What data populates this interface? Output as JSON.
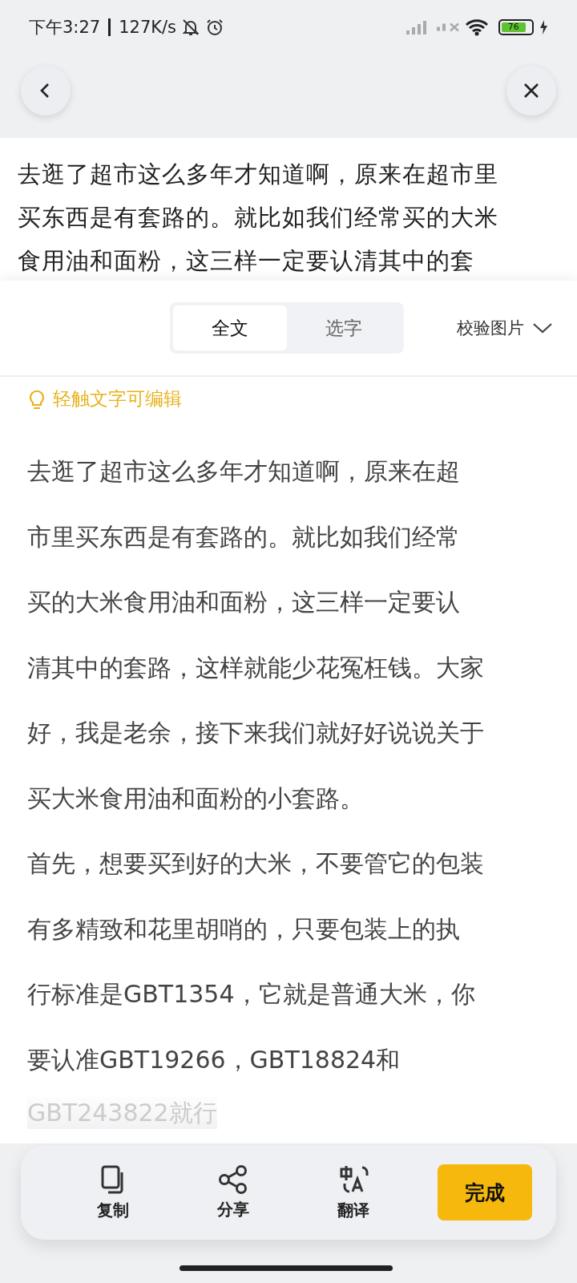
{
  "status_bar": {
    "time": "下午3:27",
    "speed": "127K/s",
    "battery": "76"
  },
  "image_text_lines": [
    "去逛了超市这么多年才知道啊，原来在超市里",
    "买东西是有套路的。就比如我们经常买的大米",
    "食用油和面粉，这三样一定要认清其中的套"
  ],
  "tabs": [
    {
      "label": "全文",
      "selected": true
    },
    {
      "label": "选字",
      "selected": false
    }
  ],
  "verify_image": "校验图片",
  "hint": "轻触文字可编辑",
  "body_lines": [
    "去逛了超市这么多年才知道啊，原来在超",
    "市里买东西是有套路的。就比如我们经常",
    "买的大米食用油和面粉，这三样一定要认",
    "清其中的套路，这样就能少花冤枉钱。大家",
    "好，我是老余，接下来我们就好好说说关于",
    "买大米食用油和面粉的小套路。",
    "首先，想要买到好的大米，不要管它的包装",
    "有多精致和花里胡哨的，只要包装上的执",
    "行标准是GBT1354，它就是普通大米，你",
    "要认准GBT19266，GBT18824和",
    "GBT243822就行"
  ],
  "toolbar": [
    {
      "kind": "copy",
      "label": "复制"
    },
    {
      "kind": "share",
      "label": "分享"
    },
    {
      "kind": "translate",
      "label": "翻译"
    }
  ],
  "done_button": "完成"
}
